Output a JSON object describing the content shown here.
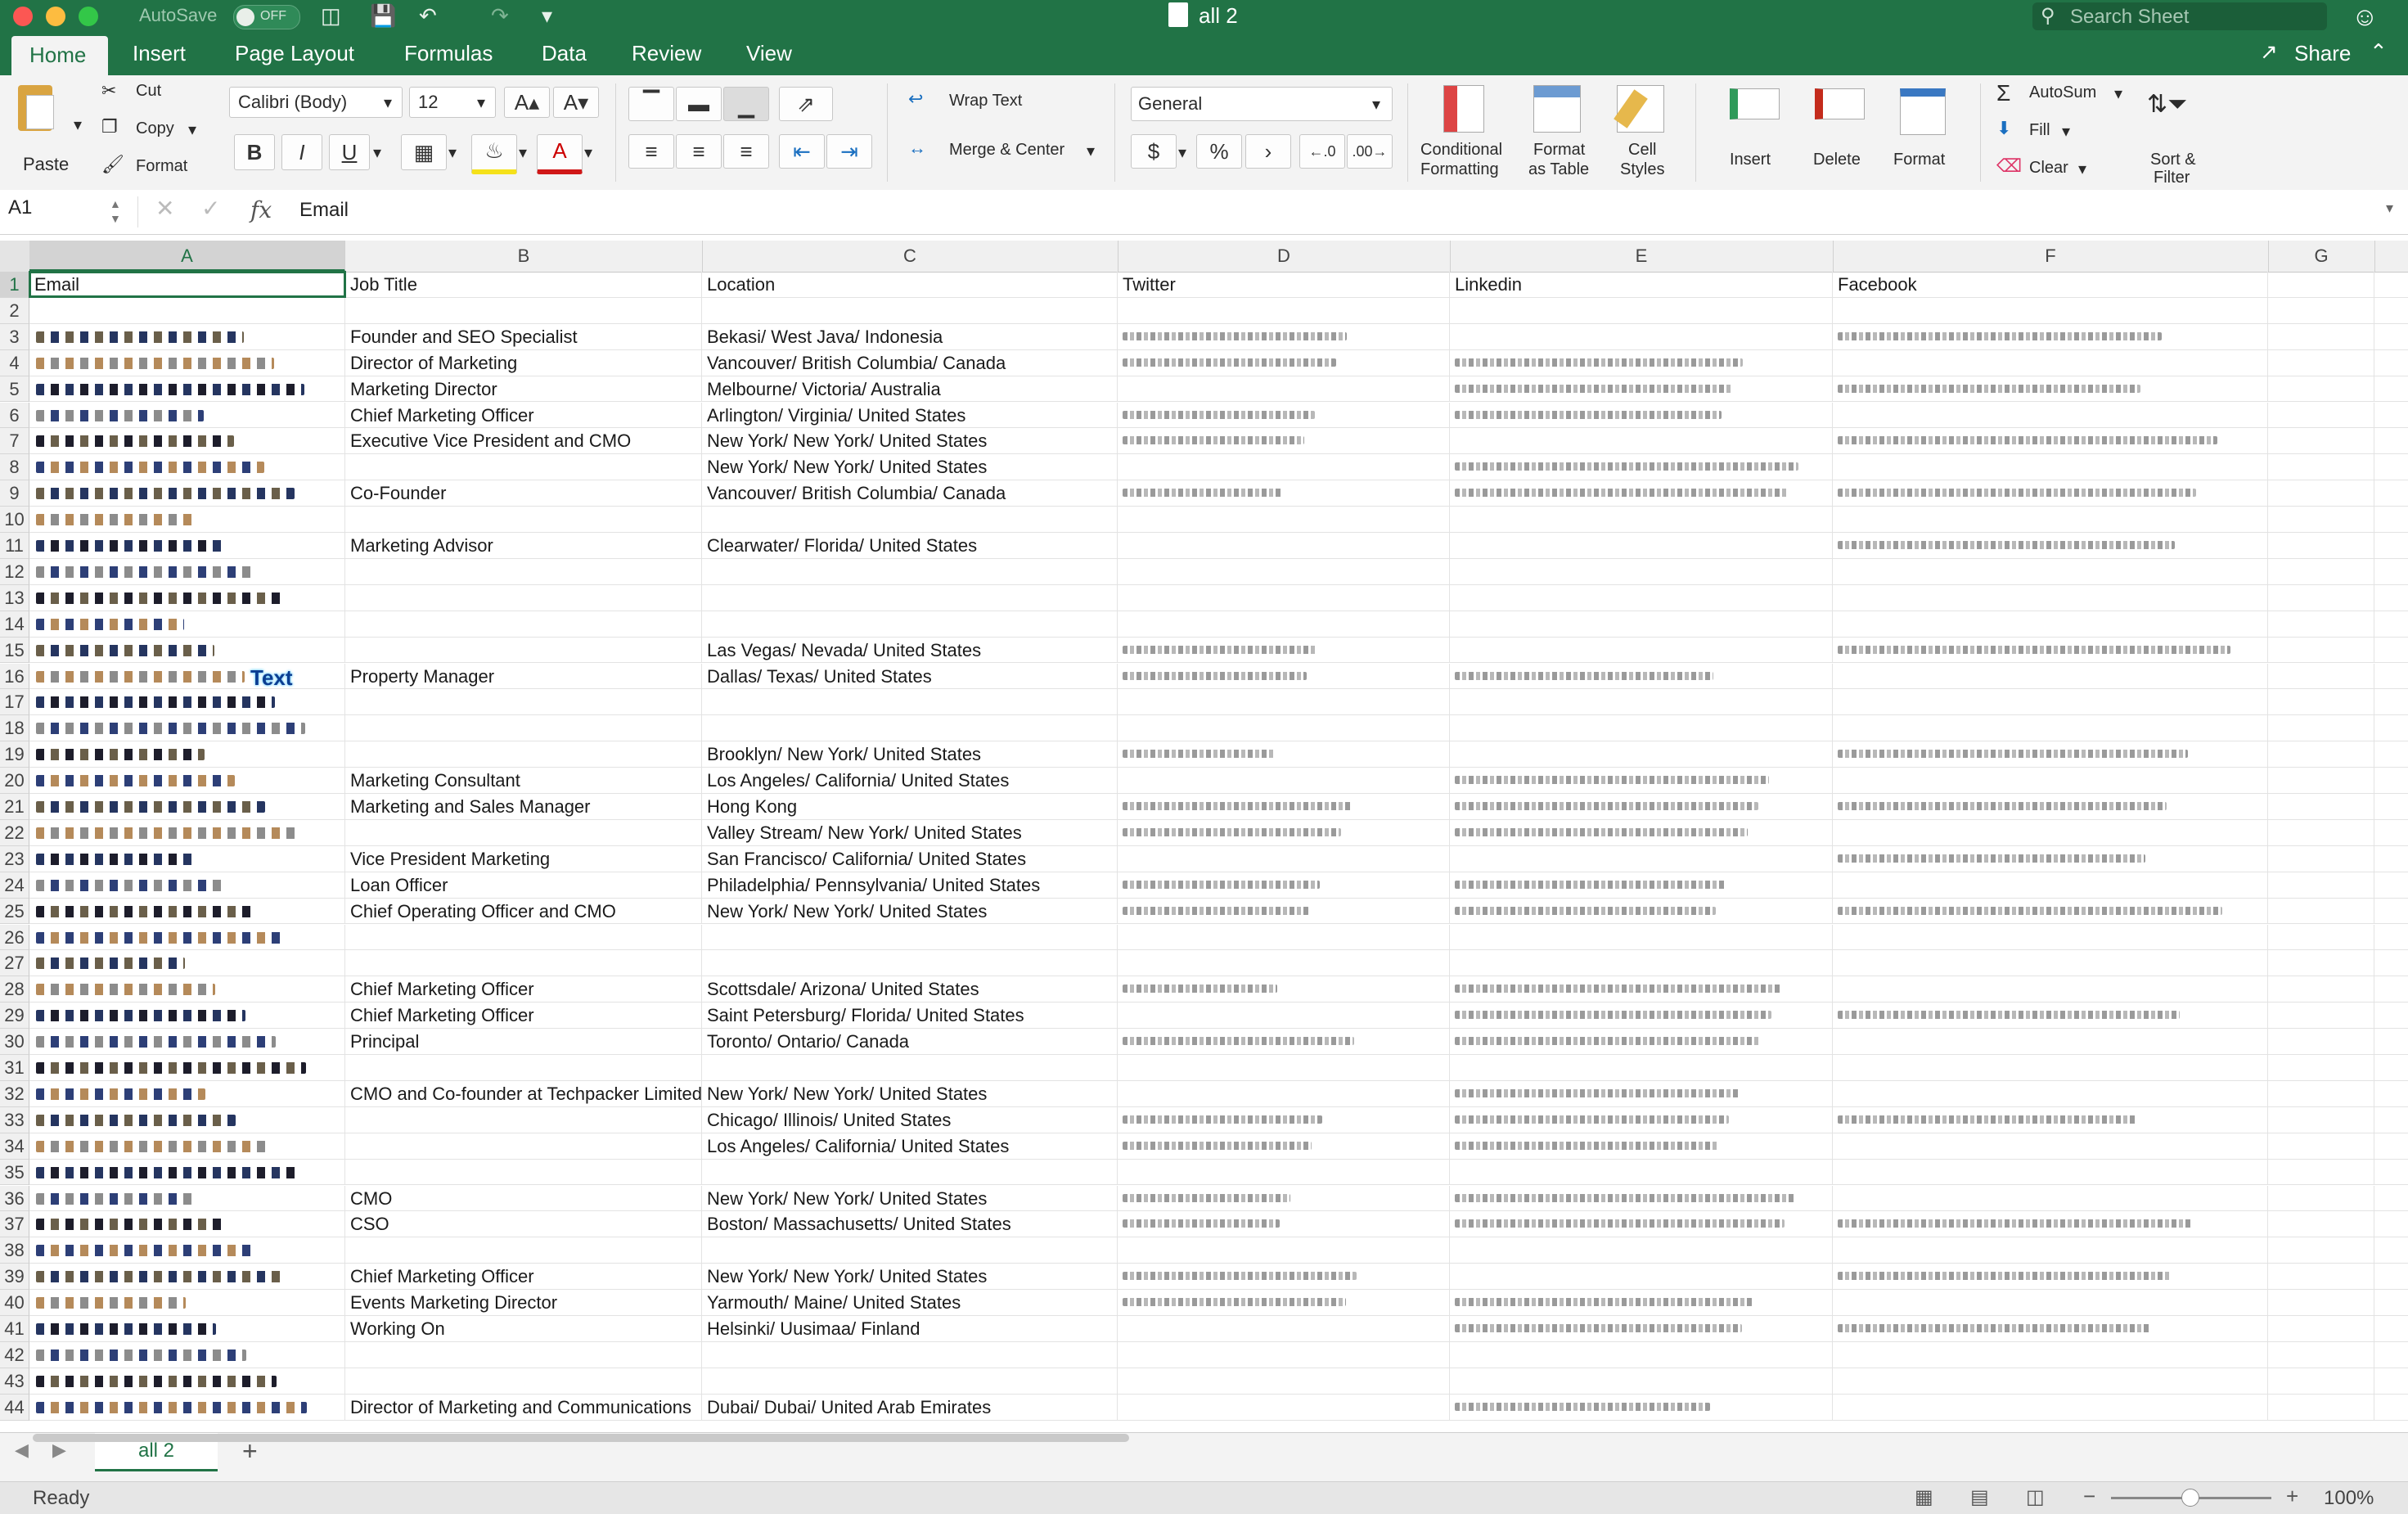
{
  "titlebar": {
    "autosave_label": "AutoSave",
    "autosave_state": "OFF",
    "title": "all 2",
    "search_placeholder": "Search Sheet"
  },
  "tabs": [
    "Home",
    "Insert",
    "Page Layout",
    "Formulas",
    "Data",
    "Review",
    "View"
  ],
  "share_label": "Share",
  "ribbon": {
    "paste": "Paste",
    "cut": "Cut",
    "copy": "Copy",
    "format_painter": "Format",
    "font_name": "Calibri (Body)",
    "font_size": "12",
    "bold": "B",
    "italic": "I",
    "underline": "U",
    "wrap_text": "Wrap Text",
    "merge_center": "Merge & Center",
    "number_format": "General",
    "currency": "$",
    "percent": "%",
    "comma": "›",
    "cond_format_1": "Conditional",
    "cond_format_2": "Formatting",
    "format_table_1": "Format",
    "format_table_2": "as Table",
    "cell_styles_1": "Cell",
    "cell_styles_2": "Styles",
    "insert": "Insert",
    "delete": "Delete",
    "format": "Format",
    "autosum": "AutoSum",
    "fill": "Fill",
    "clear": "Clear",
    "sort_filter_1": "Sort &",
    "sort_filter_2": "Filter"
  },
  "formula_bar": {
    "name_box": "A1",
    "fx": "fx",
    "content": "Email"
  },
  "columns": [
    "A",
    "B",
    "C",
    "D",
    "E",
    "F",
    "G"
  ],
  "rows": [
    {
      "n": "1",
      "job": "Job Title",
      "loc": "Location",
      "email": "Email",
      "tw": "Twitter",
      "li": "Linkedin",
      "fb": "Facebook"
    },
    {
      "n": "2",
      "job": "",
      "loc": ""
    },
    {
      "n": "3",
      "job": "Founder and SEO Specialist",
      "loc": "Bekasi/ West Java/ Indonesia"
    },
    {
      "n": "4",
      "job": "Director of Marketing",
      "loc": "Vancouver/ British Columbia/ Canada"
    },
    {
      "n": "5",
      "job": "Marketing Director",
      "loc": "Melbourne/ Victoria/ Australia"
    },
    {
      "n": "6",
      "job": "Chief Marketing Officer",
      "loc": "Arlington/ Virginia/ United States"
    },
    {
      "n": "7",
      "job": "Executive Vice President and CMO",
      "loc": "New York/ New York/ United States"
    },
    {
      "n": "8",
      "job": "",
      "loc": "New York/ New York/ United States"
    },
    {
      "n": "9",
      "job": "Co-Founder",
      "loc": "Vancouver/ British Columbia/ Canada"
    },
    {
      "n": "10",
      "job": "",
      "loc": ""
    },
    {
      "n": "11",
      "job": "Marketing Advisor",
      "loc": "Clearwater/ Florida/ United States"
    },
    {
      "n": "12",
      "job": "",
      "loc": ""
    },
    {
      "n": "13",
      "job": "",
      "loc": ""
    },
    {
      "n": "14",
      "job": "",
      "loc": ""
    },
    {
      "n": "15",
      "job": "",
      "loc": "Las Vegas/ Nevada/ United States"
    },
    {
      "n": "16",
      "job": "Property Manager",
      "loc": "Dallas/ Texas/ United States"
    },
    {
      "n": "17",
      "job": "",
      "loc": ""
    },
    {
      "n": "18",
      "job": "",
      "loc": ""
    },
    {
      "n": "19",
      "job": "",
      "loc": "Brooklyn/ New York/ United States"
    },
    {
      "n": "20",
      "job": "Marketing Consultant",
      "loc": "Los Angeles/ California/ United States"
    },
    {
      "n": "21",
      "job": "Marketing and Sales Manager",
      "loc": "Hong Kong"
    },
    {
      "n": "22",
      "job": "",
      "loc": "Valley Stream/ New York/ United States"
    },
    {
      "n": "23",
      "job": "Vice President Marketing",
      "loc": "San Francisco/ California/ United States"
    },
    {
      "n": "24",
      "job": "Loan Officer",
      "loc": "Philadelphia/ Pennsylvania/ United States"
    },
    {
      "n": "25",
      "job": "Chief Operating Officer and CMO",
      "loc": "New York/ New York/ United States"
    },
    {
      "n": "26",
      "job": "",
      "loc": ""
    },
    {
      "n": "27",
      "job": "",
      "loc": ""
    },
    {
      "n": "28",
      "job": "Chief Marketing Officer",
      "loc": "Scottsdale/ Arizona/ United States"
    },
    {
      "n": "29",
      "job": "Chief Marketing Officer",
      "loc": "Saint Petersburg/ Florida/ United States"
    },
    {
      "n": "30",
      "job": "Principal",
      "loc": "Toronto/ Ontario/ Canada"
    },
    {
      "n": "31",
      "job": "",
      "loc": ""
    },
    {
      "n": "32",
      "job": "CMO and Co-founder at Techpacker Limited",
      "loc": "New York/ New York/ United States"
    },
    {
      "n": "33",
      "job": "",
      "loc": "Chicago/ Illinois/ United States"
    },
    {
      "n": "34",
      "job": "",
      "loc": "Los Angeles/ California/ United States"
    },
    {
      "n": "35",
      "job": "",
      "loc": ""
    },
    {
      "n": "36",
      "job": "CMO",
      "loc": "New York/ New York/ United States"
    },
    {
      "n": "37",
      "job": "CSO",
      "loc": "Boston/ Massachusetts/ United States"
    },
    {
      "n": "38",
      "job": "",
      "loc": ""
    },
    {
      "n": "39",
      "job": "Chief Marketing Officer",
      "loc": "New York/ New York/ United States"
    },
    {
      "n": "40",
      "job": "Events Marketing Director",
      "loc": "Yarmouth/ Maine/ United States"
    },
    {
      "n": "41",
      "job": "Working On",
      "loc": "Helsinki/ Uusimaa/ Finland"
    },
    {
      "n": "42",
      "job": "",
      "loc": ""
    },
    {
      "n": "43",
      "job": "",
      "loc": ""
    },
    {
      "n": "44",
      "job": "Director of Marketing and Communications",
      "loc": "Dubai/ Dubai/ United Arab Emirates"
    }
  ],
  "overlay_text": "Text",
  "sheet_tab": "all 2",
  "status": "Ready",
  "zoom": "100%"
}
